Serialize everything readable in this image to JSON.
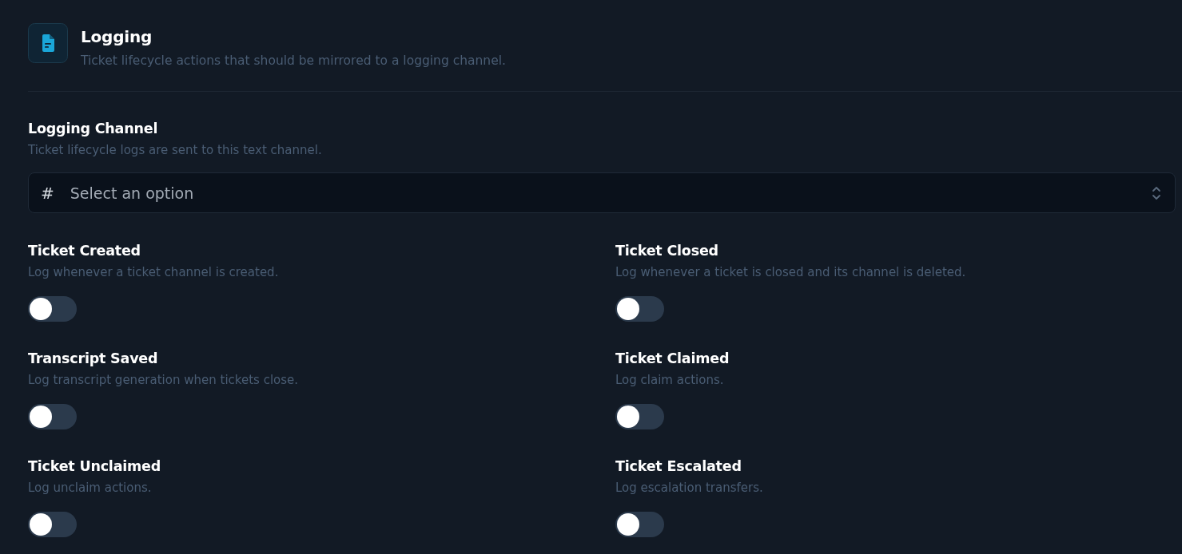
{
  "header": {
    "title": "Logging",
    "subtitle": "Ticket lifecycle actions that should be mirrored to a logging channel."
  },
  "logging_channel": {
    "label": "Logging Channel",
    "description": "Ticket lifecycle logs are sent to this text channel.",
    "select": {
      "prefix": "#",
      "placeholder": "Select an option"
    }
  },
  "toggles": [
    {
      "title": "Ticket Created",
      "description": "Log whenever a ticket channel is created.",
      "on": false
    },
    {
      "title": "Ticket Closed",
      "description": "Log whenever a ticket is closed and its channel is deleted.",
      "on": false
    },
    {
      "title": "Transcript Saved",
      "description": "Log transcript generation when tickets close.",
      "on": false
    },
    {
      "title": "Ticket Claimed",
      "description": "Log claim actions.",
      "on": false
    },
    {
      "title": "Ticket Unclaimed",
      "description": "Log unclaim actions.",
      "on": false
    },
    {
      "title": "Ticket Escalated",
      "description": "Log escalation transfers.",
      "on": false
    }
  ]
}
